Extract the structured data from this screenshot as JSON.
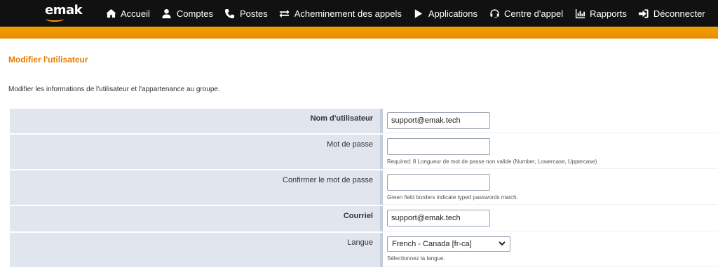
{
  "nav": {
    "logo": "emak",
    "items": [
      {
        "label": "Accueil",
        "icon": "home-icon"
      },
      {
        "label": "Comptes",
        "icon": "user-icon"
      },
      {
        "label": "Postes",
        "icon": "phone-icon"
      },
      {
        "label": "Acheminement des appels",
        "icon": "arrows-exchange-icon"
      },
      {
        "label": "Applications",
        "icon": "play-icon"
      },
      {
        "label": "Centre d'appel",
        "icon": "headset-icon"
      },
      {
        "label": "Rapports",
        "icon": "chart-icon"
      },
      {
        "label": "Déconnecter",
        "icon": "sign-out-icon"
      }
    ]
  },
  "page": {
    "title": "Modifier l'utilisateur",
    "description": "Modifier les informations de l'utilisateur et l'appartenance au groupe."
  },
  "form": {
    "username_label": "Nom d'utilisateur",
    "username_value": "support@emak.tech",
    "password_label": "Mot de passe",
    "password_value": "",
    "password_hint": "Required: 8 Longueur de mot de passe non valide (Number, Lowercase, Uppercase)",
    "confirm_label": "Confirmer le mot de passe",
    "confirm_value": "",
    "confirm_hint": "Green field borders indicate typed passwords match.",
    "email_label": "Courriel",
    "email_value": "support@emak.tech",
    "language_label": "Langue",
    "language_value": "French - Canada [fr-ca]",
    "language_hint": "Sélectionnez la langue."
  },
  "colors": {
    "nav_bg": "#111111",
    "accent_orange": "#e98d00",
    "title_orange": "#e87d00",
    "label_bg": "#e1e6ee"
  }
}
